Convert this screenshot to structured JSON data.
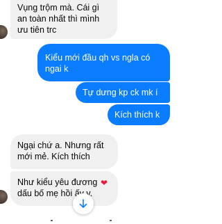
{
  "messages": [
    {
      "side": "in",
      "lines": [
        "Vụng trộm mà. Cái gì",
        "an toàn nhất thì mình",
        "ưu tiên trc"
      ]
    },
    {
      "side": "out",
      "lines": [
        "Kiểu mới đầu qh vs ngla có",
        "ngai k"
      ]
    },
    {
      "side": "out",
      "lines": [
        "Tự dưng kp ck mk í"
      ]
    },
    {
      "side": "out",
      "lines": [
        "Kích thích k"
      ]
    },
    {
      "side": "in",
      "lines": [
        "Ngại chứ a. Nhưng rất",
        "mới mẻ. Kích thích"
      ]
    },
    {
      "side": "in",
      "lines": [
        "Như kiểu yêu đương",
        "dấu bố mẹ hồi ấy v."
      ]
    }
  ],
  "reaction": {
    "emoji": "❤",
    "color": "#e41e3f"
  },
  "colors": {
    "outgoing": "#0a7cff",
    "incoming": "#f0f0f0",
    "accent": "#0a7cff"
  },
  "icons": {
    "scroll": "arrow-down-icon",
    "reaction": "heart-icon"
  }
}
